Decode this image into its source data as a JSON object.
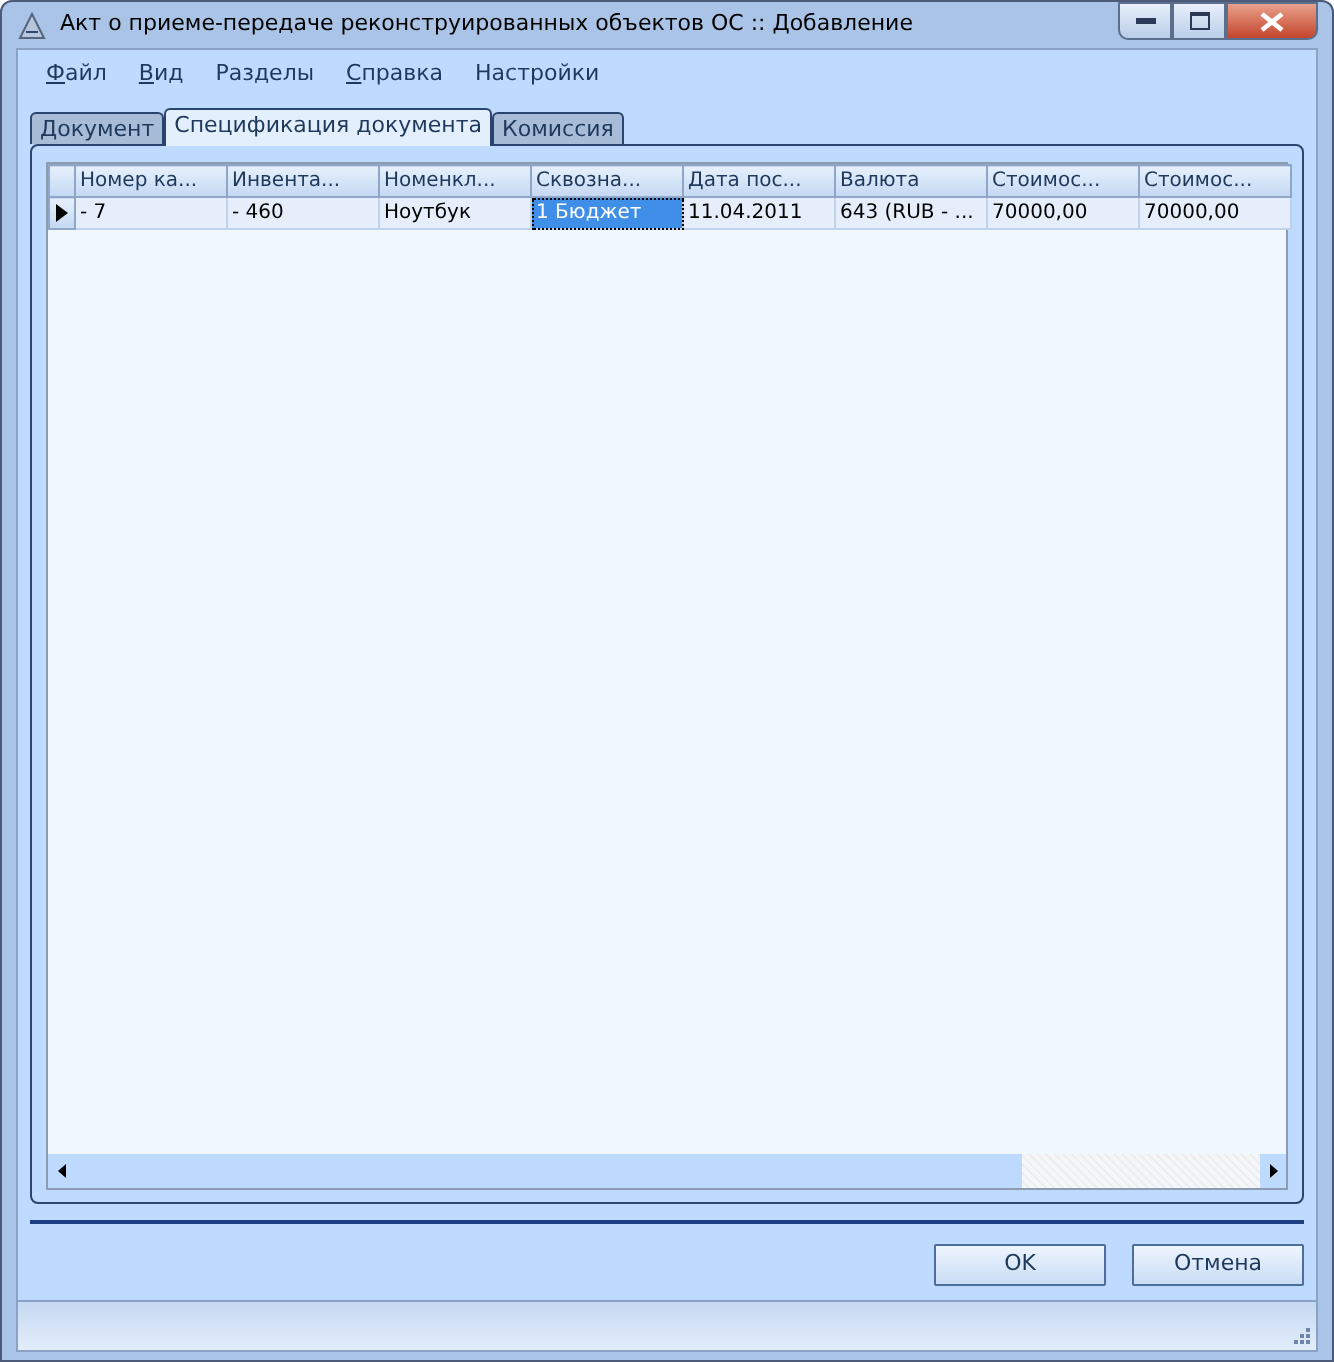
{
  "window": {
    "title": "Акт о приеме-передаче реконструированных объектов ОС :: Добавление"
  },
  "menu": [
    {
      "label": "Файл",
      "mnemonic": true
    },
    {
      "label": "Вид",
      "mnemonic": true
    },
    {
      "label": "Разделы",
      "mnemonic": false
    },
    {
      "label": "Справка",
      "mnemonic": true
    },
    {
      "label": "Настройки",
      "mnemonic": false
    }
  ],
  "tabs": [
    {
      "label": "Документ",
      "selected": false
    },
    {
      "label": "Спецификация документа",
      "selected": true
    },
    {
      "label": "Комиссия",
      "selected": false
    }
  ],
  "table": {
    "columns": [
      "Номер ка...",
      "Инвента...",
      "Номенкл...",
      "Сквозна...",
      "Дата пос...",
      "Валюта",
      "Стоимос...",
      "Стоимос..."
    ],
    "rows": [
      {
        "current": true,
        "cells": [
          {
            "text": " - 7",
            "selected": false
          },
          {
            "text": " - 460",
            "selected": false
          },
          {
            "text": "Ноутбук",
            "selected": false
          },
          {
            "text": "1 Бюджет",
            "selected": true
          },
          {
            "text": "11.04.2011",
            "selected": false
          },
          {
            "text": "643 (RUB - ...",
            "selected": false
          },
          {
            "text": "70000,00",
            "selected": false
          },
          {
            "text": "70000,00",
            "selected": false
          }
        ]
      }
    ]
  },
  "buttons": [
    {
      "label": "OK"
    },
    {
      "label": "Отмена"
    }
  ]
}
